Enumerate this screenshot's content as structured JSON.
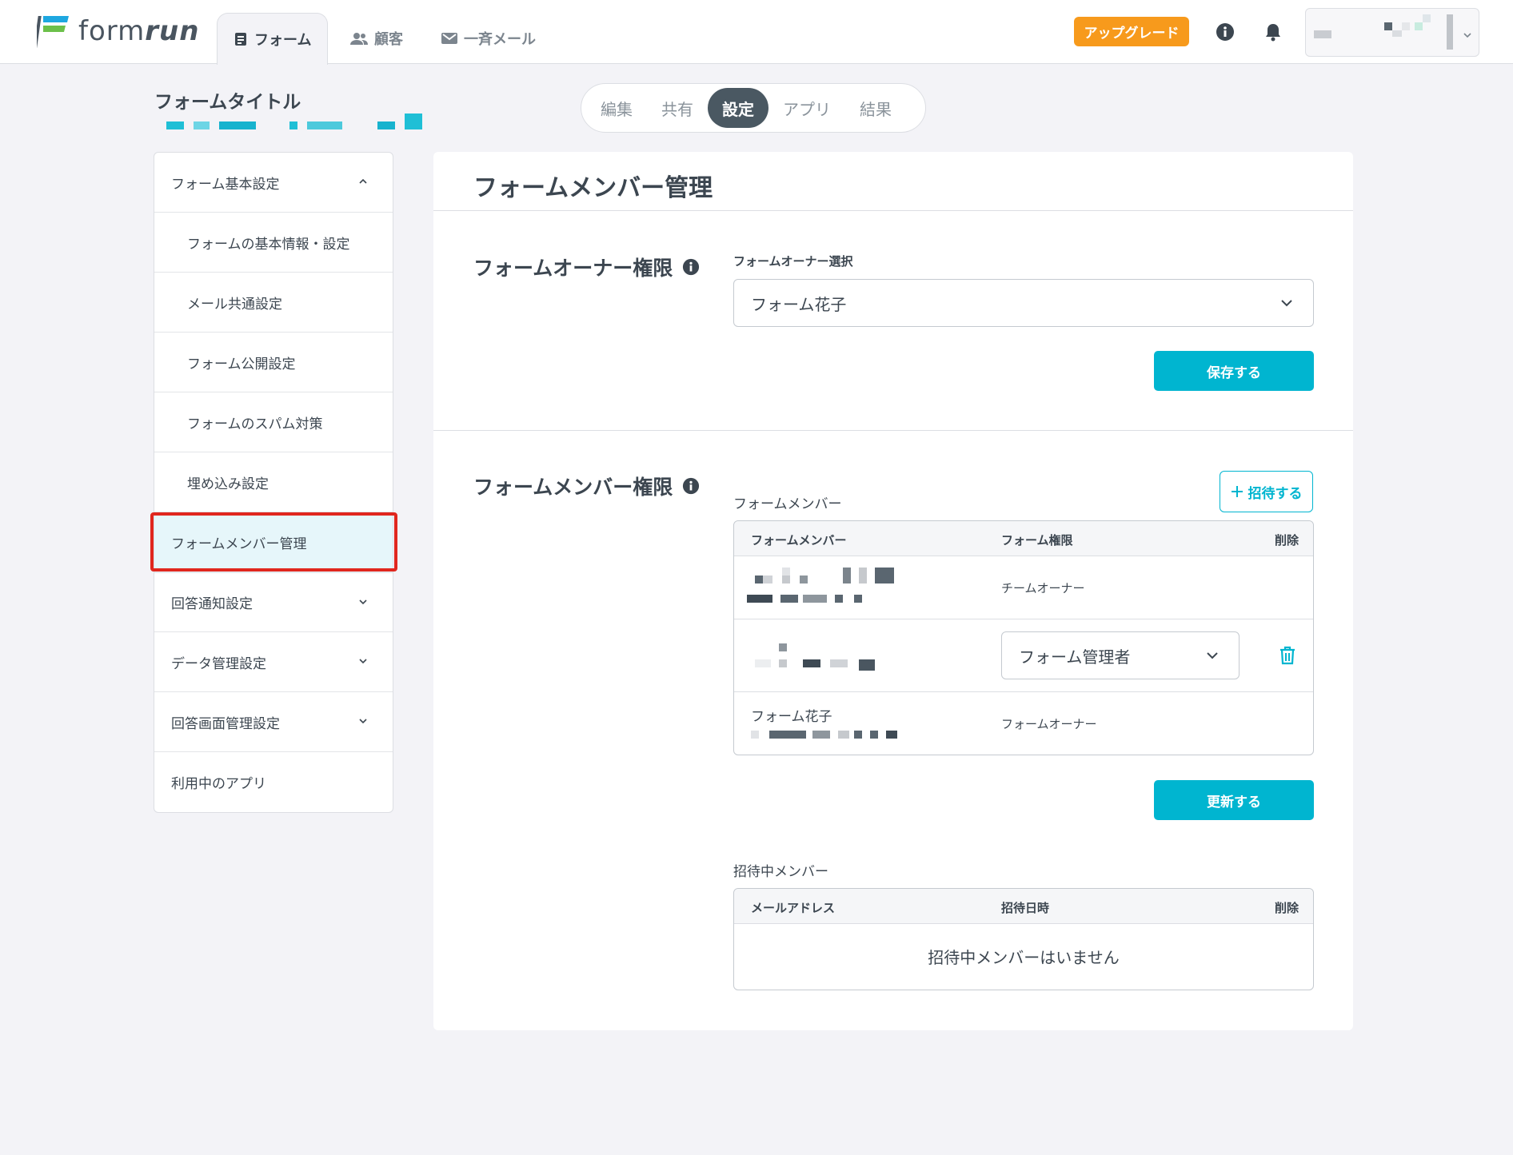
{
  "header": {
    "logo_text_light": "form",
    "logo_text_bold": "run",
    "tabs": [
      {
        "label": "フォーム",
        "icon": "form-doc-icon"
      },
      {
        "label": "顧客",
        "icon": "people-icon"
      },
      {
        "label": "一斉メール",
        "icon": "mail-icon"
      }
    ],
    "upgrade_label": "アップグレード"
  },
  "form": {
    "title": "フォームタイトル"
  },
  "sub_tabs": [
    "編集",
    "共有",
    "設定",
    "アプリ",
    "結果"
  ],
  "sidebar": {
    "items": [
      {
        "label": "フォーム基本設定"
      },
      {
        "label": "フォームの基本情報・設定"
      },
      {
        "label": "メール共通設定"
      },
      {
        "label": "フォーム公開設定"
      },
      {
        "label": "フォームのスパム対策"
      },
      {
        "label": "埋め込み設定"
      },
      {
        "label": "フォームメンバー管理"
      },
      {
        "label": "回答通知設定"
      },
      {
        "label": "データ管理設定"
      },
      {
        "label": "回答画面管理設定"
      },
      {
        "label": "利用中のアプリ"
      }
    ]
  },
  "main": {
    "title": "フォームメンバー管理",
    "owner_section": {
      "title": "フォームオーナー権限",
      "field_label": "フォームオーナー選択",
      "selected_owner": "フォーム花子",
      "save_label": "保存する"
    },
    "member_section": {
      "title": "フォームメンバー権限",
      "members_label": "フォームメンバー",
      "invite_label": "招待する",
      "columns": [
        "フォームメンバー",
        "フォーム権限",
        "削除"
      ],
      "rows": [
        {
          "name": "",
          "permission": "チームオーナー"
        },
        {
          "name": "",
          "permission_select": "フォーム管理者"
        },
        {
          "name": "フォーム花子",
          "permission": "フォームオーナー"
        }
      ],
      "update_label": "更新する",
      "pending_label": "招待中メンバー",
      "pending_columns": [
        "メールアドレス",
        "招待日時",
        "削除"
      ],
      "pending_empty": "招待中メンバーはいません"
    }
  },
  "colors": {
    "accent": "#00b5d0",
    "upgrade": "#f79a1c",
    "highlight": "#e0271e",
    "active_tab": "#4a5862"
  }
}
